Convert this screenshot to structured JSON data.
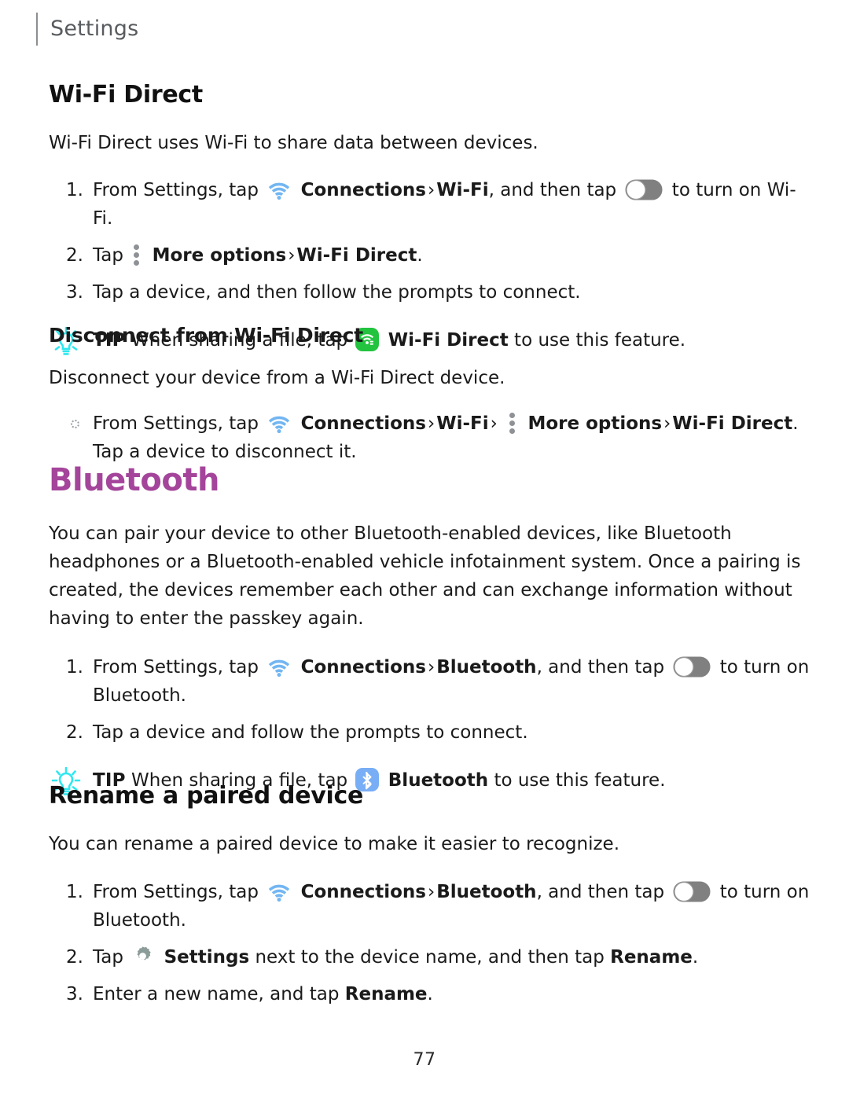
{
  "header": {
    "title": "Settings"
  },
  "colors": {
    "accent_heading": "#a4459b",
    "wifi_icon": "#72b6f2",
    "wifi_direct_badge": "#22c33f",
    "bluetooth_badge": "#78aef5",
    "tip_bulb": "#2ee8ef",
    "gear_icon": "#8b9c99",
    "toggle_track": "#808080",
    "dots_icon": "#8e9296"
  },
  "sections": {
    "wifi_direct": {
      "heading": "Wi-Fi Direct",
      "intro": "Wi-Fi Direct uses Wi-Fi to share data between devices.",
      "steps": [
        {
          "marker": "1.",
          "pre": "From Settings, tap",
          "icon": "wifi-icon",
          "bold1": "Connections",
          "sep1": "›",
          "bold2": "Wi-Fi",
          "mid": ", and then tap",
          "toggle": "toggle-switch-icon",
          "post": "to turn on Wi-Fi."
        },
        {
          "marker": "2.",
          "pre": "Tap",
          "icon": "more-options-icon",
          "bold1": "More options",
          "sep1": "›",
          "bold2": "Wi-Fi Direct",
          "post": "."
        },
        {
          "marker": "3.",
          "text": "Tap a device, and then follow the prompts to connect."
        }
      ],
      "tip": {
        "label": "TIP",
        "pre": "When sharing a file, tap",
        "icon": "wifi-direct-badge-icon",
        "bold": "Wi-Fi Direct",
        "post": "to use this feature."
      }
    },
    "disconnect": {
      "heading": "Disconnect from Wi-Fi Direct",
      "intro": "Disconnect your device from a Wi-Fi Direct device.",
      "bullet": {
        "pre": "From Settings, tap",
        "icon": "wifi-icon",
        "bold1": "Connections",
        "sep1": "›",
        "bold2": "Wi-Fi",
        "sep2": "›",
        "dots": "more-options-icon",
        "bold3": "More options",
        "sep3": "›",
        "bold4": "Wi-Fi Direct",
        "post": ". Tap a device to disconnect it."
      }
    },
    "bluetooth": {
      "heading": "Bluetooth",
      "intro": "You can pair your device to other Bluetooth-enabled devices, like Bluetooth headphones or a Bluetooth-enabled vehicle infotainment system. Once a pairing is created, the devices remember each other and can exchange information without having to enter the passkey again.",
      "steps": [
        {
          "marker": "1.",
          "pre": "From Settings, tap",
          "icon": "wifi-icon",
          "bold1": "Connections",
          "sep1": "›",
          "bold2": "Bluetooth",
          "mid": ", and then tap",
          "toggle": "toggle-switch-icon",
          "post": "to turn on Bluetooth."
        },
        {
          "marker": "2.",
          "text": "Tap a device and follow the prompts to connect."
        }
      ],
      "tip": {
        "label": "TIP",
        "pre": "When sharing a file, tap",
        "icon": "bluetooth-badge-icon",
        "bold": "Bluetooth",
        "post": "to use this feature."
      }
    },
    "rename": {
      "heading": "Rename a paired device",
      "intro": "You can rename a paired device to make it easier to recognize.",
      "steps": [
        {
          "marker": "1.",
          "pre": "From Settings, tap",
          "icon": "wifi-icon",
          "bold1": "Connections",
          "sep1": "›",
          "bold2": "Bluetooth",
          "mid": ", and then tap",
          "toggle": "toggle-switch-icon",
          "post": "to turn on Bluetooth."
        },
        {
          "marker": "2.",
          "pre": "Tap",
          "icon": "gear-icon",
          "bold1": "Settings",
          "mid": "next to the device name, and then tap",
          "bold2": "Rename",
          "post": "."
        },
        {
          "marker": "3.",
          "pre": "Enter a new name, and tap",
          "bold1": "Rename",
          "post": "."
        }
      ]
    }
  },
  "footer": {
    "page_number": "77"
  }
}
